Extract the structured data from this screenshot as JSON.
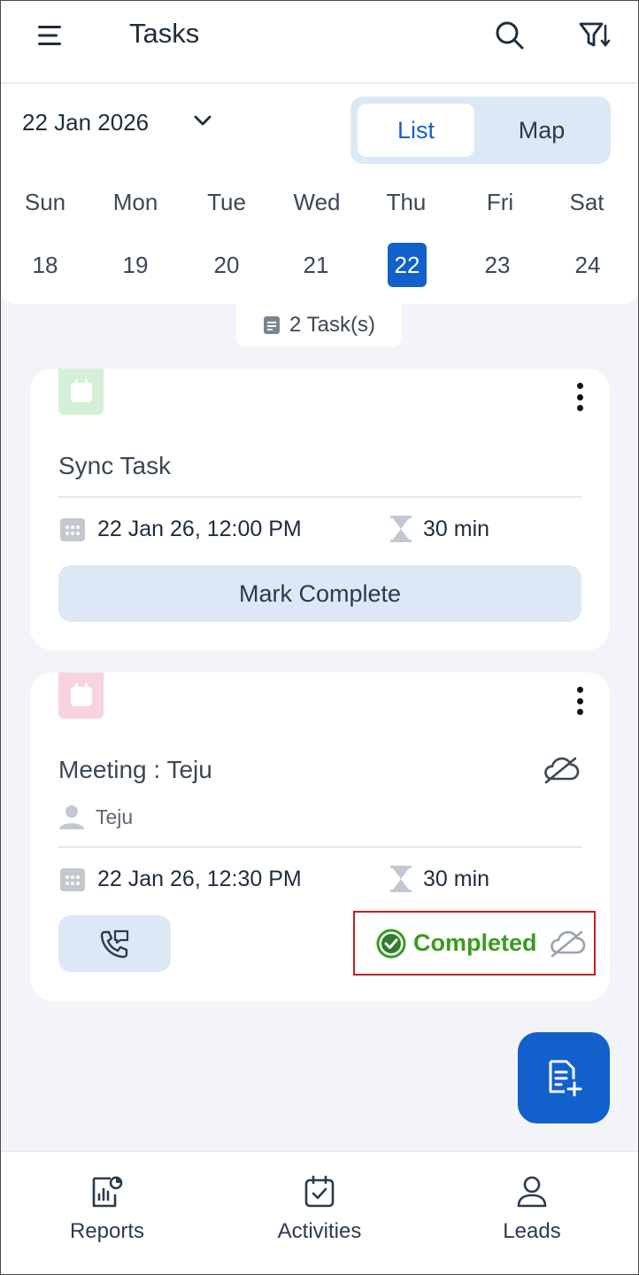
{
  "header": {
    "title": "Tasks"
  },
  "date_picker": {
    "label": "22 Jan 2026"
  },
  "view_toggle": {
    "list": "List",
    "map": "Map",
    "selected": "List"
  },
  "week": {
    "days": [
      "Sun",
      "Mon",
      "Tue",
      "Wed",
      "Thu",
      "Fri",
      "Sat"
    ],
    "dates": [
      "18",
      "19",
      "20",
      "21",
      "22",
      "23",
      "24"
    ],
    "selected_date": "22"
  },
  "task_count": "2 Task(s)",
  "tasks": [
    {
      "title": "Sync Task",
      "datetime": "22 Jan 26, 12:00 PM",
      "duration": "30 min",
      "action": "Mark Complete",
      "tag_color": "#d3f0d6"
    },
    {
      "title": "Meeting : Teju",
      "owner": "Teju",
      "datetime": "22 Jan 26, 12:30 PM",
      "duration": "30 min",
      "status": "Completed",
      "tag_color": "#f8d3df"
    }
  ],
  "bottom_nav": {
    "reports": "Reports",
    "activities": "Activities",
    "leads": "Leads"
  },
  "icons": {
    "menu": "hamburger-icon",
    "search": "search-icon",
    "filter": "filter-sort-icon",
    "chevron": "chevron-down-icon",
    "task_count": "document-icon",
    "tag": "calendar-icon",
    "more": "kebab-menu-icon",
    "date": "calendar-grid-icon",
    "duration": "hourglass-icon",
    "owner": "person-icon",
    "sync": "cloud-off-icon",
    "call": "phone-call-icon",
    "status": "check-circle-icon",
    "fab": "add-note-icon",
    "reports": "report-chart-icon",
    "activities": "calendar-check-icon",
    "leads": "person-outline-icon"
  },
  "colors": {
    "primary": "#1260cc",
    "success": "#3a9b1f",
    "highlight": "#c42020"
  }
}
